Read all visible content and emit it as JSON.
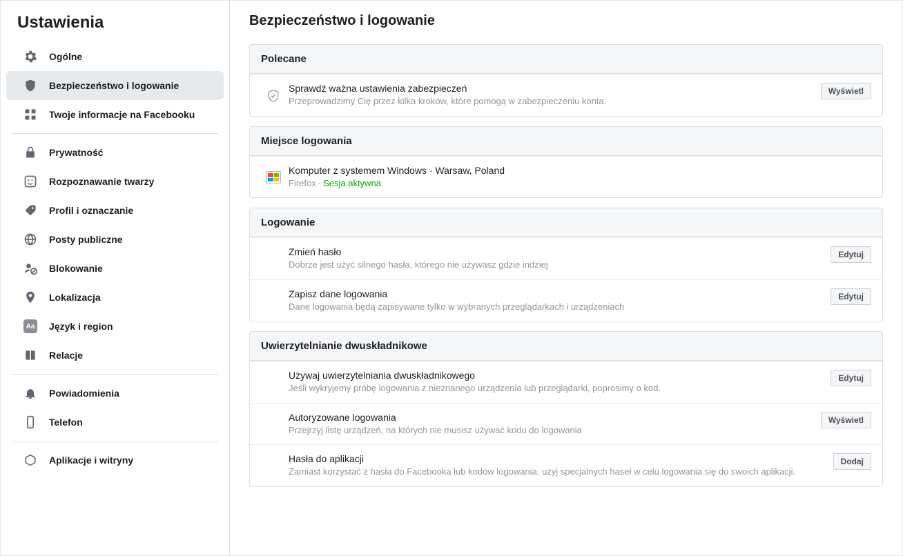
{
  "sidebar": {
    "title": "Ustawienia",
    "groups": [
      [
        {
          "id": "general",
          "label": "Ogólne",
          "icon": "gear"
        },
        {
          "id": "security",
          "label": "Bezpieczeństwo i logowanie",
          "icon": "shield",
          "active": true
        },
        {
          "id": "yourinfo",
          "label": "Twoje informacje na Facebooku",
          "icon": "grid"
        }
      ],
      [
        {
          "id": "privacy",
          "label": "Prywatność",
          "icon": "lock"
        },
        {
          "id": "face",
          "label": "Rozpoznawanie twarzy",
          "icon": "face"
        },
        {
          "id": "profile",
          "label": "Profil i oznaczanie",
          "icon": "tag"
        },
        {
          "id": "public",
          "label": "Posty publiczne",
          "icon": "globe"
        },
        {
          "id": "blocking",
          "label": "Blokowanie",
          "icon": "block"
        },
        {
          "id": "location",
          "label": "Lokalizacja",
          "icon": "pin"
        },
        {
          "id": "language",
          "label": "Język i region",
          "icon": "aa"
        },
        {
          "id": "stories",
          "label": "Relacje",
          "icon": "book"
        }
      ],
      [
        {
          "id": "notifications",
          "label": "Powiadomienia",
          "icon": "bell"
        },
        {
          "id": "mobile",
          "label": "Telefon",
          "icon": "phone"
        }
      ],
      [
        {
          "id": "apps",
          "label": "Aplikacje i witryny",
          "icon": "cube"
        }
      ]
    ]
  },
  "page": {
    "title": "Bezpieczeństwo i logowanie",
    "buttons": {
      "view": "Wyświetl",
      "edit": "Edytuj",
      "add": "Dodaj"
    },
    "sections": [
      {
        "id": "recommended",
        "header": "Polecane",
        "rows": [
          {
            "icon": "shield-check",
            "title": "Sprawdź ważna ustawienia zabezpieczeń",
            "sub": "Przeprowadzimy Cię przez kilka kroków, które pomogą w zabezpieczeniu konta.",
            "action": "view"
          }
        ]
      },
      {
        "id": "where",
        "header": "Miejsce logowania",
        "rows": [
          {
            "icon": "windows",
            "title": "Komputer z systemem Windows · Warsaw, Poland",
            "sub_prefix": "Firefox",
            "sub_active": "Sesja aktywna"
          }
        ]
      },
      {
        "id": "login",
        "header": "Logowanie",
        "rows": [
          {
            "title": "Zmień hasło",
            "sub": "Dobrze jest użyć silnego hasła, którego nie używasz gdzie indziej",
            "action": "edit"
          },
          {
            "title": "Zapisz dane logowania",
            "sub": "Dane logowania będą zapisywane tylko w wybranych przeglądarkach i urządzeniach",
            "action": "edit"
          }
        ]
      },
      {
        "id": "twofa",
        "header": "Uwierzytelnianie dwuskładnikowe",
        "rows": [
          {
            "title": "Używaj uwierzytelniania dwuskładnikowego",
            "sub": "Jeśli wykryjemy próbę logowania z nieznanego urządzenia lub przeglądarki, poprosimy o kod.",
            "action": "edit"
          },
          {
            "title": "Autoryzowane logowania",
            "sub": "Przejrzyj listę urządzeń, na których nie musisz używać kodu do logowania",
            "action": "view"
          },
          {
            "title": "Hasła do aplikacji",
            "sub": "Zamiast korzystać z hasła do Facebooka lub kodów logowania, użyj specjalnych haseł w celu logowania się do swoich aplikacji.",
            "action": "add"
          }
        ]
      }
    ]
  }
}
